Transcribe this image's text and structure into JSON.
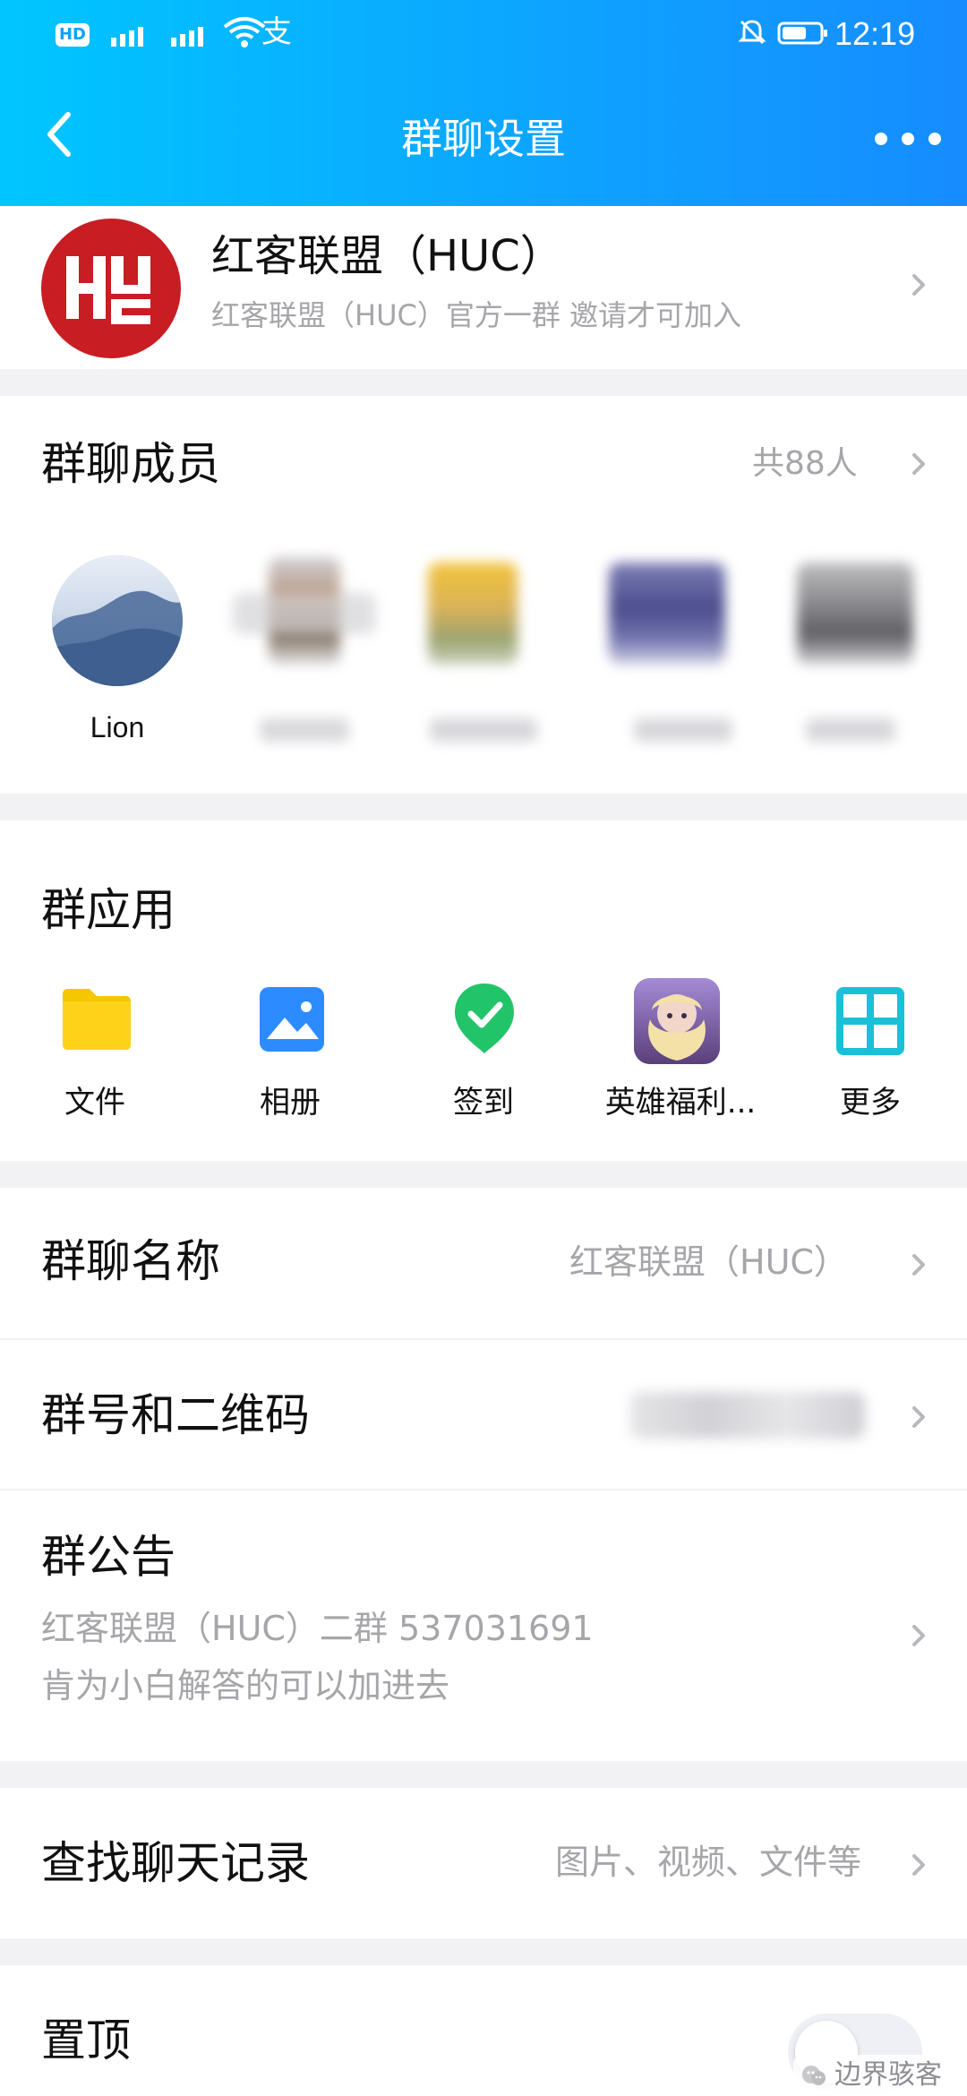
{
  "status_bar": {
    "left_icons": [
      "hd-icon",
      "signal-icon",
      "signal-icon",
      "wifi-icon",
      "alipay-icon"
    ],
    "time": "12:19"
  },
  "header": {
    "title": "群聊设置",
    "back_icon": "back-arrow-icon",
    "more_icon": "more-dots-icon"
  },
  "group": {
    "name": "红客联盟（HUC）",
    "description": "红客联盟（HUC）官方一群 邀请才可加入",
    "avatar_text": "HUC"
  },
  "members": {
    "title": "群聊成员",
    "count_text": "共88人",
    "first_member_name": "Lion"
  },
  "apps": {
    "title": "群应用",
    "items": [
      {
        "label": "文件",
        "icon": "folder-icon"
      },
      {
        "label": "相册",
        "icon": "album-icon"
      },
      {
        "label": "签到",
        "icon": "checkin-icon"
      },
      {
        "label": "英雄福利...",
        "icon": "hero-welfare-icon"
      },
      {
        "label": "更多",
        "icon": "more-apps-icon"
      }
    ]
  },
  "settings": {
    "group_name_label": "群聊名称",
    "group_name_value": "红客联盟（HUC）",
    "group_qr_label": "群号和二维码",
    "notice_label": "群公告",
    "notice_line1": "红客联盟（HUC）二群 537031691",
    "notice_line2": "肯为小白解答的可以加进去",
    "search_label": "查找聊天记录",
    "search_value": "图片、视频、文件等",
    "pin_label": "置顶"
  },
  "watermark": {
    "text": "边界骇客"
  },
  "colors": {
    "header_gradient_start": "#00c6ff",
    "header_gradient_end": "#168cff",
    "text_primary": "#111111",
    "text_muted": "#a6a6aa",
    "logo_red": "#c81d22"
  }
}
